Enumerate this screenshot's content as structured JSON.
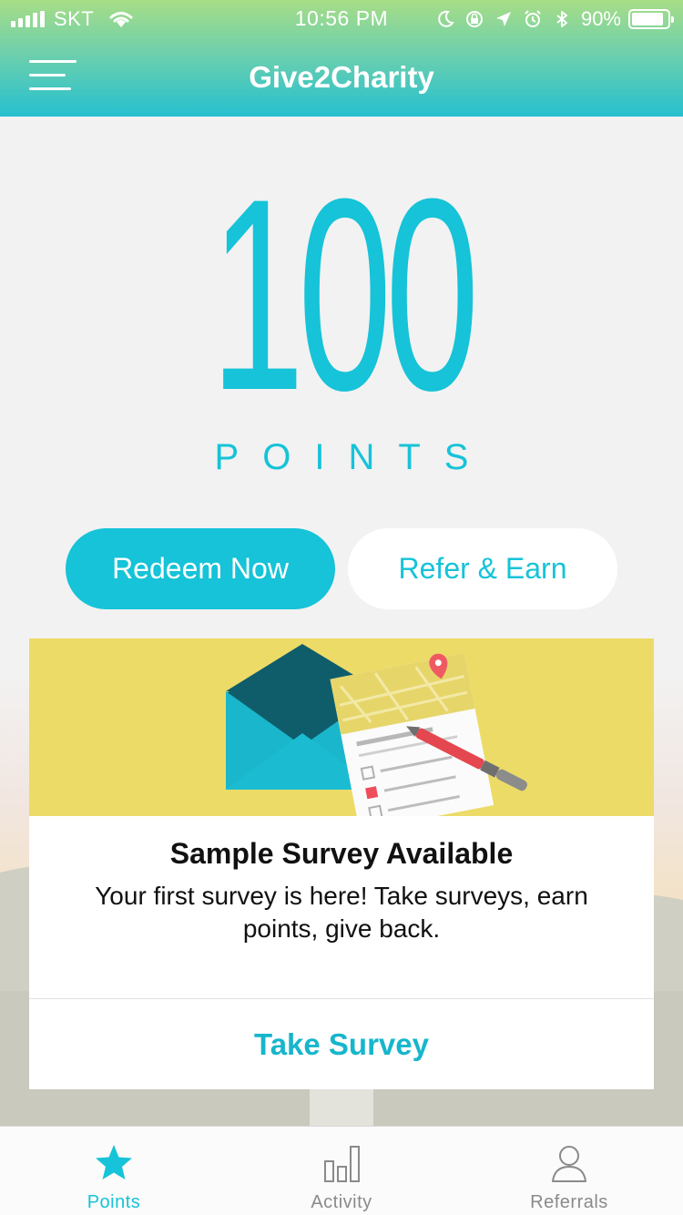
{
  "status_bar": {
    "carrier": "SKT",
    "time": "10:56 PM",
    "battery_percent": "90%",
    "battery_level": 0.9,
    "icons": [
      "signal-icon",
      "wifi-icon",
      "moon-icon",
      "rotation-lock-icon",
      "location-icon",
      "alarm-icon",
      "bluetooth-icon",
      "battery-icon"
    ]
  },
  "header": {
    "title": "Give2Charity",
    "menu_icon": "hamburger-menu-icon"
  },
  "points": {
    "value": "100",
    "label": "POINTS"
  },
  "actions": {
    "redeem_label": "Redeem Now",
    "refer_label": "Refer & Earn"
  },
  "survey_card": {
    "illustration": "survey-envelope-illustration",
    "title": "Sample Survey Available",
    "description": "Your first survey is here! Take surveys, earn points, give back.",
    "action_label": "Take Survey"
  },
  "tab_bar": {
    "tabs": [
      {
        "label": "Points",
        "icon": "star-icon",
        "active": true
      },
      {
        "label": "Activity",
        "icon": "bar-chart-icon",
        "active": false
      },
      {
        "label": "Referrals",
        "icon": "person-icon",
        "active": false
      }
    ]
  },
  "colors": {
    "accent": "#16c3d8",
    "banner": "#ecdb67",
    "background": "#f2f2f2"
  }
}
